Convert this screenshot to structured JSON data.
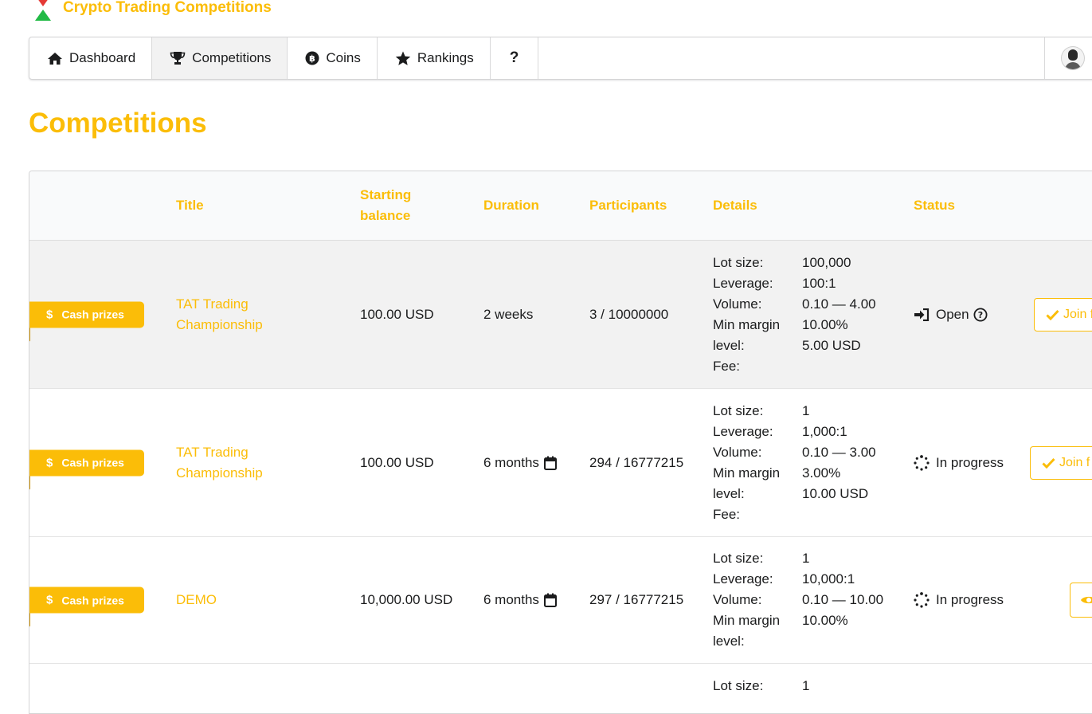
{
  "app": {
    "name": "Crypto Trading Competitions"
  },
  "nav": {
    "items": [
      {
        "label": "Dashboard",
        "icon": "home-icon"
      },
      {
        "label": "Competitions",
        "icon": "trophy-icon",
        "active": true
      },
      {
        "label": "Coins",
        "icon": "bitcoin-icon"
      },
      {
        "label": "Rankings",
        "icon": "star-icon"
      },
      {
        "label": "?",
        "icon": "help"
      }
    ]
  },
  "page": {
    "title": "Competitions"
  },
  "table": {
    "headers": {
      "title": "Title",
      "starting_balance": "Starting balance",
      "duration": "Duration",
      "participants": "Participants",
      "details": "Details",
      "status": "Status"
    },
    "details_labels": {
      "lot_size": "Lot size:",
      "leverage": "Leverage:",
      "volume": "Volume:",
      "min_margin": "Min margin",
      "level": "level:",
      "fee": "Fee:"
    },
    "rows": [
      {
        "badge": "Cash prizes",
        "title": "TAT Trading Championship",
        "starting_balance": "100.00 USD",
        "duration": "2 weeks",
        "participants": "3 / 10000000",
        "details": {
          "lot_size": "100,000",
          "leverage": "100:1",
          "volume": "0.10 — 4.00",
          "min_margin_level": "10.00%",
          "fee": "5.00 USD"
        },
        "status": "Open",
        "action": "Join f"
      },
      {
        "badge": "Cash prizes",
        "title": "TAT Trading Championship",
        "starting_balance": "100.00 USD",
        "duration": "6 months",
        "participants": "294 / 16777215",
        "details": {
          "lot_size": "1",
          "leverage": "1,000:1",
          "volume": "0.10 — 3.00",
          "min_margin_level": "3.00%",
          "fee": "10.00 USD"
        },
        "status": "In progress",
        "action": "Join f"
      },
      {
        "badge": "Cash prizes",
        "title": "DEMO",
        "starting_balance": "10,000.00 USD",
        "duration": "6 months",
        "participants": "297 / 16777215",
        "details": {
          "lot_size": "1",
          "leverage": "10,000:1",
          "volume": "0.10 — 10.00",
          "min_margin_level": "10.00%"
        },
        "status": "In progress"
      },
      {
        "details": {
          "lot_size": "1"
        }
      }
    ]
  },
  "colors": {
    "accent": "#fbbd08",
    "text": "#1b1c1d",
    "border": "#d4d4d5"
  }
}
